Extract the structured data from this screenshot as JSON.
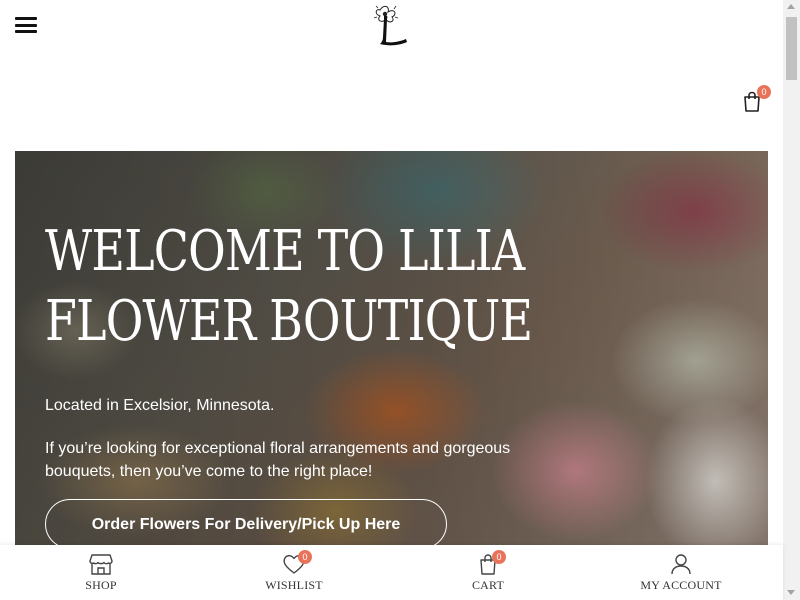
{
  "header": {
    "menu_icon": "hamburger-menu-icon",
    "logo_icon": "lilia-logo",
    "cart_icon": "shopping-bag-icon",
    "cart_count": "0"
  },
  "hero": {
    "title_line1": "WELCOME TO LILIA",
    "title_line2": "FLOWER BOUTIQUE",
    "location": "Located in Excelsior, Minnesota.",
    "description": "If you’re looking for exceptional floral arrangements and gorgeous bouquets, then you’ve come to the right place!",
    "cta_label": "Order Flowers For Delivery/Pick Up Here"
  },
  "bottom_nav": {
    "shop_label": "SHOP",
    "shop_icon": "storefront-icon",
    "wishlist_label": "WISHLIST",
    "wishlist_icon": "heart-icon",
    "wishlist_count": "0",
    "cart_label": "CART",
    "cart_icon": "shopping-bag-icon",
    "cart_count": "0",
    "account_label": "MY ACCOUNT",
    "account_icon": "user-icon"
  },
  "colors": {
    "badge": "#e8735a",
    "text_dark": "#222222",
    "hero_text": "#ffffff"
  }
}
